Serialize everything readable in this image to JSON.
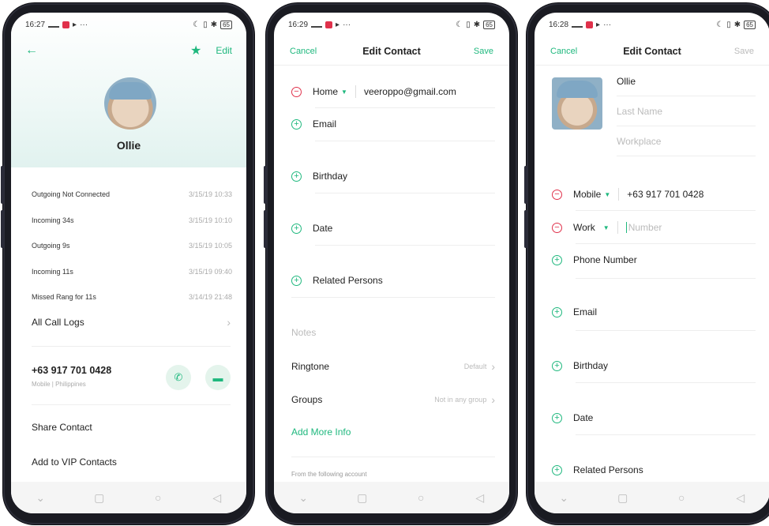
{
  "screen1": {
    "status": {
      "time": "16:27",
      "battery": "65"
    },
    "edit_label": "Edit",
    "contact_name": "Ollie",
    "call_logs": [
      {
        "type": "Outgoing Not Connected",
        "time": "3/15/19 10:33"
      },
      {
        "type": "Incoming 34s",
        "time": "3/15/19 10:10"
      },
      {
        "type": "Outgoing 9s",
        "time": "3/15/19 10:05"
      },
      {
        "type": "Incoming 11s",
        "time": "3/15/19 09:40"
      },
      {
        "type": "Missed Rang for 11s",
        "time": "3/14/19 21:48"
      }
    ],
    "all_call_logs": "All Call Logs",
    "phone_number": "+63 917 701 0428",
    "phone_meta": "Mobile | Philippines",
    "share_contact": "Share Contact",
    "add_vip": "Add to VIP Contacts"
  },
  "screen2": {
    "status": {
      "time": "16:29",
      "battery": "65"
    },
    "cancel": "Cancel",
    "title": "Edit Contact",
    "save": "Save",
    "email_type": "Home",
    "email_value": "veeroppo@gmail.com",
    "add_email": "Email",
    "birthday": "Birthday",
    "date": "Date",
    "related_persons": "Related Persons",
    "notes": "Notes",
    "ringtone": "Ringtone",
    "ringtone_value": "Default",
    "groups": "Groups",
    "groups_value": "Not in any group",
    "add_more_info": "Add More Info",
    "account_label": "From the following account"
  },
  "screen3": {
    "status": {
      "time": "16:28",
      "battery": "65"
    },
    "cancel": "Cancel",
    "title": "Edit Contact",
    "save": "Save",
    "first_name": "Ollie",
    "last_name_placeholder": "Last Name",
    "workplace_placeholder": "Workplace",
    "phone1_type": "Mobile",
    "phone1_value": "+63 917 701 0428",
    "phone2_type": "Work",
    "phone2_placeholder": "Number",
    "add_phone": "Phone Number",
    "email": "Email",
    "birthday": "Birthday",
    "date": "Date",
    "related_persons": "Related Persons"
  },
  "colors": {
    "accent": "#1fb87e",
    "danger": "#e0314b",
    "frame": "#1a1b22"
  }
}
